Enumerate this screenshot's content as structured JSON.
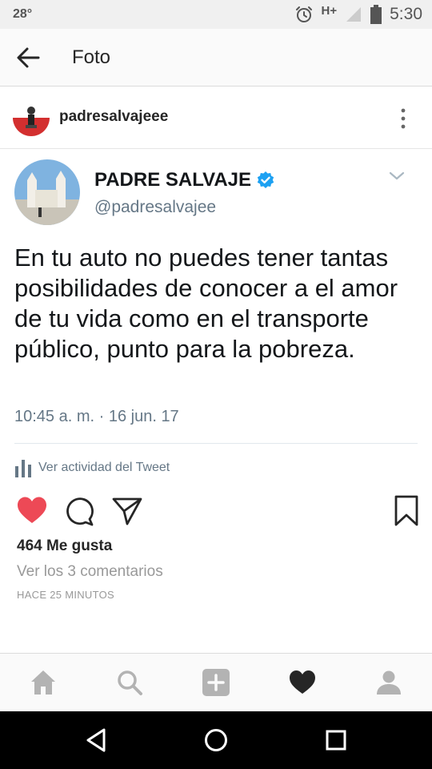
{
  "status_bar": {
    "temperature": "28°",
    "network": "H+",
    "time": "5:30",
    "icons": [
      "alarm-icon",
      "signal-icon",
      "battery-icon"
    ]
  },
  "app_bar": {
    "title": "Foto",
    "back_icon": "arrow-left-icon"
  },
  "post": {
    "username": "padresalvajeee",
    "more_icon": "vertical-dots-icon",
    "likes": "464 Me gusta",
    "comments_link": "Ver los 3 comentarios",
    "posted_ago": "HACE 25 MINUTOS",
    "actions": [
      "heart-filled-icon",
      "comment-icon",
      "send-icon",
      "bookmark-icon"
    ],
    "liked": true
  },
  "tweet": {
    "display_name": "PADRE SALVAJE",
    "handle": "@padresalvajee",
    "verified": true,
    "text": "En tu auto no puedes tener tantas posibilidades de conocer a el amor de tu vida como en el transporte público, punto para la pobreza.",
    "timestamp": "10:45 a. m. · 16 jun. 17",
    "activity_label": "Ver actividad del Tweet"
  },
  "bottom_nav": {
    "tabs": [
      "home-icon",
      "search-icon",
      "add-icon",
      "activity-heart-icon",
      "profile-icon"
    ],
    "active": "activity-heart-icon"
  },
  "colors": {
    "like_red": "#ed4956",
    "twitter_blue": "#1da1f2",
    "text_dark": "#262626",
    "text_muted": "#999999"
  }
}
